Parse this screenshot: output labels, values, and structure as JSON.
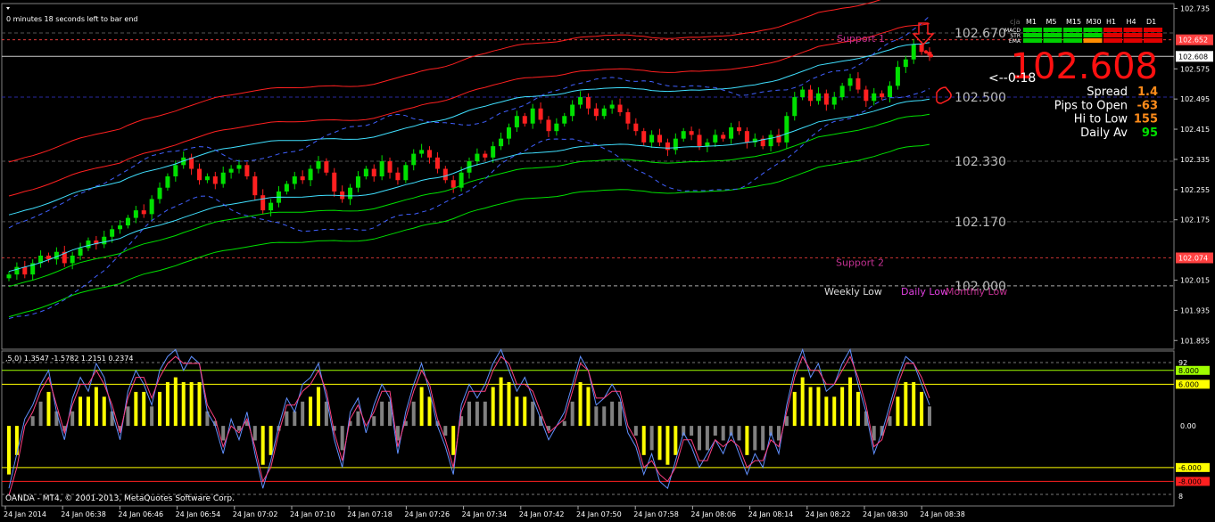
{
  "window": {
    "countdown_text": "0 minutes 18 seconds left to bar end",
    "copyright_text": "OANDA - MT4, © 2001-2013, MetaQuotes Software Corp."
  },
  "panel": {
    "corner_label": "cja",
    "timeframes": [
      "M1",
      "M5",
      "M15",
      "M30",
      "H1",
      "H4",
      "D1"
    ],
    "row_labels": [
      "MACD",
      "STR",
      "EMA"
    ],
    "signal_colors": {
      "MACD": [
        "#00d000",
        "#00d000",
        "#00d000",
        "#00d000",
        "#e00000",
        "#e00000",
        "#e00000"
      ],
      "STR": [
        "#00d000",
        "#00d000",
        "#00d000",
        "#00d000",
        "#e00000",
        "#e00000",
        "#e00000"
      ],
      "EMA": [
        "#00d000",
        "#00d000",
        "#00d000",
        "#ff8c00",
        "#e00000",
        "#e00000",
        "#e00000"
      ]
    },
    "big_price": "102.608",
    "countdown_arrow": "<--0:18",
    "stats": [
      {
        "label": "Spread",
        "value": "1.4",
        "color": "#ff8c1a"
      },
      {
        "label": "Pips to Open",
        "value": "-63",
        "color": "#ff8c1a"
      },
      {
        "label": "Hi to Low",
        "value": "155",
        "color": "#ff8c1a"
      },
      {
        "label": "Daily Av",
        "value": "95",
        "color": "#00e000"
      }
    ],
    "arrow_icon": "down-arrow-icon",
    "thumb_icon": "thumbs-down-icon"
  },
  "chart_data": [
    {
      "type": "candlestick",
      "symbol_price_axis": [
        "102.735",
        "102.652",
        "102.608",
        "102.575",
        "102.495",
        "102.415",
        "102.335",
        "102.255",
        "102.175",
        "102.074",
        "102.015",
        "101.935",
        "101.855"
      ],
      "ylim": [
        101.832,
        102.748
      ],
      "bid_line": 102.608,
      "bid_label": "102.608",
      "tag_prices": [
        {
          "value": "102.652",
          "color": "#ff4040"
        },
        {
          "value": "102.074",
          "color": "#ff4040"
        }
      ],
      "level_lines": [
        {
          "price": 102.67,
          "label": "102.670",
          "color": "#555555",
          "style": "dashed"
        },
        {
          "price": 102.5,
          "label": "102.500",
          "color": "#2a2aa0",
          "style": "dashed"
        },
        {
          "price": 102.33,
          "label": "102.330",
          "color": "#555555",
          "style": "dashed"
        },
        {
          "price": 102.17,
          "label": "102.170",
          "color": "#555555",
          "style": "dashed"
        },
        {
          "price": 102.0,
          "label": "102.000",
          "color": "#aaaaaa",
          "style": "dashed"
        }
      ],
      "annotations": [
        {
          "text": "Support 1",
          "price": 102.656,
          "color": "#c03090"
        },
        {
          "text": "Support 2",
          "price": 102.062,
          "color": "#c03090"
        },
        {
          "text": "Weekly Low",
          "price": 101.985,
          "color": "#dddddd"
        },
        {
          "text": "Daily Low",
          "price": 101.985,
          "color": "#e040e0"
        },
        {
          "text": "Monthly Low",
          "price": 101.985,
          "color": "#c03090"
        }
      ],
      "x_labels": [
        "24 Jan 2014",
        "24 Jan 06:38",
        "24 Jan 06:46",
        "24 Jan 06:54",
        "24 Jan 07:02",
        "24 Jan 07:10",
        "24 Jan 07:18",
        "24 Jan 07:26",
        "24 Jan 07:34",
        "24 Jan 07:42",
        "24 Jan 07:50",
        "24 Jan 07:58",
        "24 Jan 08:06",
        "24 Jan 08:14",
        "24 Jan 08:22",
        "24 Jan 08:30",
        "24 Jan 08:38"
      ],
      "closes": [
        102.03,
        102.05,
        102.03,
        102.06,
        102.08,
        102.07,
        102.09,
        102.06,
        102.08,
        102.1,
        102.12,
        102.11,
        102.13,
        102.15,
        102.16,
        102.18,
        102.2,
        102.19,
        102.23,
        102.26,
        102.29,
        102.32,
        102.34,
        102.31,
        102.28,
        102.29,
        102.27,
        102.3,
        102.31,
        102.32,
        102.29,
        102.24,
        102.2,
        102.22,
        102.25,
        102.27,
        102.29,
        102.28,
        102.31,
        102.33,
        102.3,
        102.25,
        102.23,
        102.26,
        102.29,
        102.31,
        102.29,
        102.33,
        102.3,
        102.28,
        102.32,
        102.35,
        102.36,
        102.34,
        102.31,
        102.28,
        102.26,
        102.3,
        102.33,
        102.35,
        102.34,
        102.37,
        102.39,
        102.42,
        102.45,
        102.43,
        102.47,
        102.44,
        102.41,
        102.43,
        102.45,
        102.48,
        102.5,
        102.47,
        102.45,
        102.47,
        102.48,
        102.46,
        102.43,
        102.41,
        102.38,
        102.4,
        102.38,
        102.36,
        102.39,
        102.41,
        102.4,
        102.37,
        102.38,
        102.4,
        102.39,
        102.42,
        102.41,
        102.38,
        102.39,
        102.37,
        102.4,
        102.38,
        102.45,
        102.5,
        102.52,
        102.49,
        102.51,
        102.48,
        102.5,
        102.53,
        102.55,
        102.52,
        102.49,
        102.51,
        102.5,
        102.53,
        102.58,
        102.6,
        102.64,
        102.62,
        102.61
      ],
      "opens_offset": -0.015
    },
    {
      "type": "line",
      "title": ",5,0) 1.3547 -1.5782 1.2151 0.2374",
      "ylim": [
        -10,
        92
      ],
      "y_ticks": [
        "92",
        "0.00",
        "8"
      ],
      "levels": [
        {
          "value": 8.0,
          "label": "8.000",
          "color": "#a0ff00"
        },
        {
          "value": 6.0,
          "label": "6.000",
          "color": "#ffff00"
        },
        {
          "value": -6.0,
          "label": "-6.000",
          "color": "#ffff00"
        },
        {
          "value": -8.0,
          "label": "-8.000",
          "color": "#ff2020"
        }
      ],
      "series": [
        {
          "color": "#6090ff",
          "values": [
            -9,
            -4,
            1,
            3,
            6,
            8,
            2,
            -2,
            4,
            7,
            5,
            9,
            7,
            2,
            -2,
            5,
            8,
            6,
            3,
            8,
            10,
            11,
            8,
            10,
            9,
            2,
            0,
            -4,
            1,
            -2,
            2,
            -4,
            -9,
            -5,
            0,
            4,
            2,
            6,
            7,
            9,
            4,
            -2,
            -6,
            2,
            4,
            -1,
            3,
            6,
            4,
            -4,
            2,
            6,
            9,
            5,
            0,
            -3,
            -7,
            3,
            6,
            4,
            6,
            9,
            11,
            8,
            5,
            7,
            4,
            1,
            -2,
            0,
            2,
            6,
            10,
            8,
            3,
            4,
            6,
            4,
            -1,
            -3,
            -7,
            -4,
            -8,
            -9,
            -5,
            -1,
            -3,
            -6,
            -4,
            -2,
            -4,
            -1,
            -4,
            -7,
            -4,
            -6,
            -1,
            -4,
            3,
            8,
            11,
            7,
            9,
            5,
            6,
            9,
            11,
            6,
            2,
            -4,
            -1,
            3,
            7,
            10,
            9,
            6,
            3
          ]
        },
        {
          "color": "#ff4080",
          "values": [
            -10,
            -6,
            0,
            2,
            5,
            7,
            3,
            -1,
            3,
            6,
            6,
            8,
            6,
            3,
            -1,
            4,
            7,
            7,
            4,
            7,
            9,
            10,
            9,
            9,
            9,
            3,
            1,
            -3,
            0,
            -1,
            1,
            -3,
            -8,
            -6,
            -1,
            3,
            3,
            5,
            6,
            8,
            5,
            -1,
            -5,
            1,
            3,
            0,
            2,
            5,
            5,
            -3,
            1,
            5,
            8,
            6,
            1,
            -2,
            -6,
            2,
            5,
            5,
            5,
            8,
            10,
            9,
            6,
            6,
            5,
            2,
            -1,
            0,
            1,
            5,
            9,
            8,
            4,
            4,
            5,
            5,
            0,
            -2,
            -6,
            -5,
            -7,
            -8,
            -6,
            -2,
            -2,
            -5,
            -5,
            -2,
            -3,
            -2,
            -3,
            -6,
            -5,
            -5,
            -2,
            -3,
            2,
            7,
            10,
            8,
            8,
            6,
            6,
            8,
            10,
            7,
            3,
            -3,
            -2,
            2,
            6,
            9,
            9,
            7,
            4
          ]
        }
      ]
    }
  ]
}
